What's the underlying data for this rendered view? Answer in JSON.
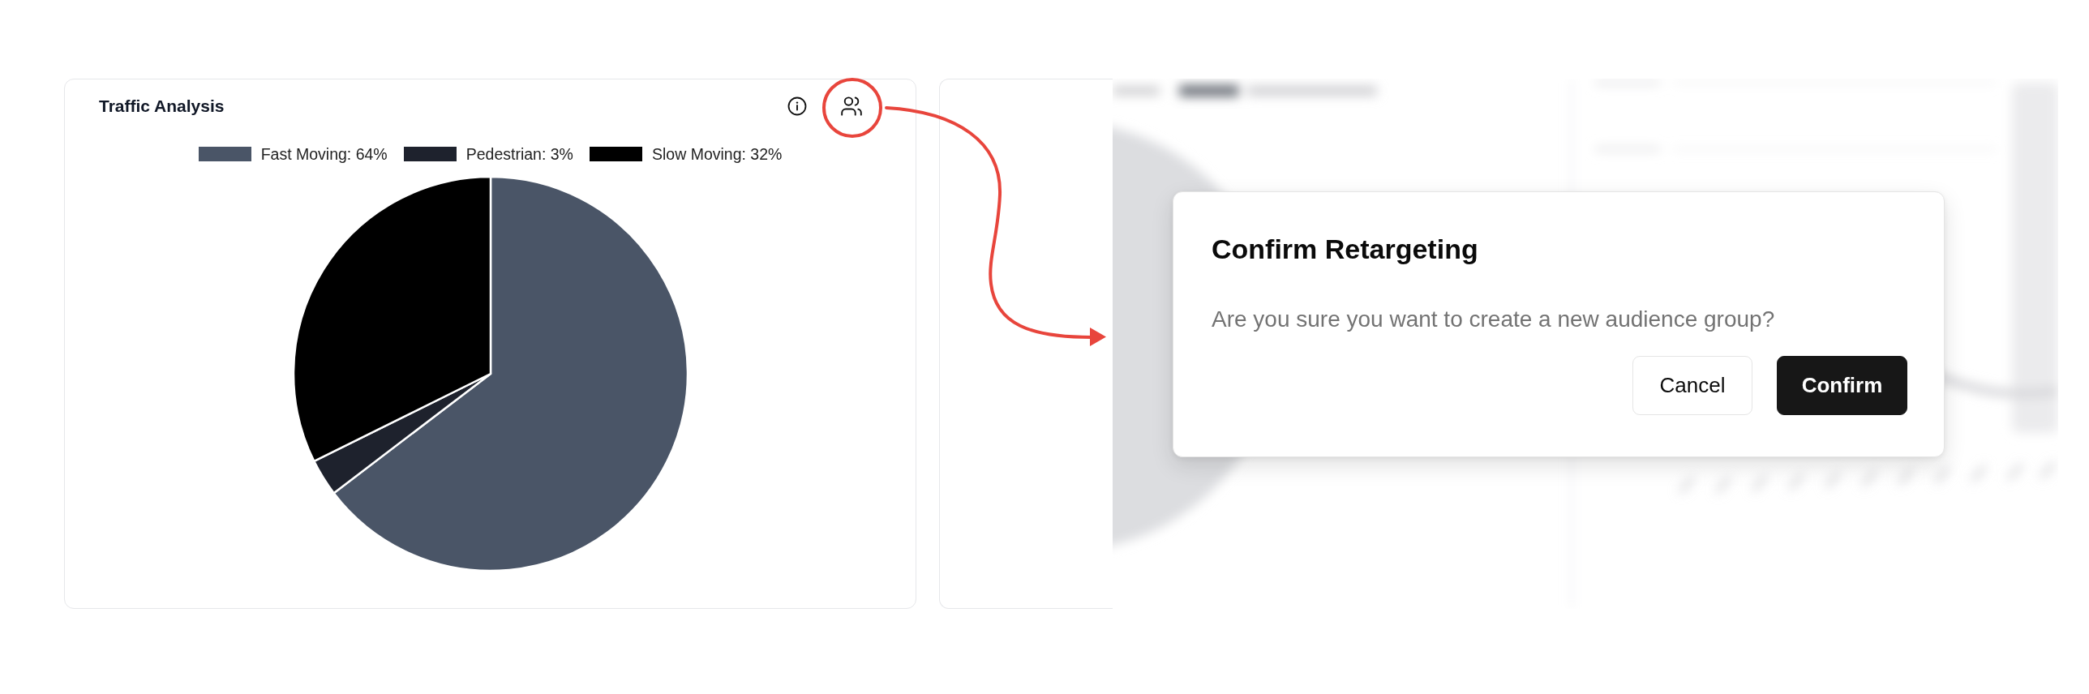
{
  "chart_card": {
    "title": "Traffic Analysis",
    "legend": [
      {
        "label": "Fast Moving: 64%",
        "color": "#4a5567"
      },
      {
        "label": "Pedestrian: 3%",
        "color": "#1e222d"
      },
      {
        "label": "Slow Moving: 32%",
        "color": "#000000"
      }
    ],
    "chart_data": {
      "type": "pie",
      "values": [
        64,
        3,
        32
      ]
    }
  },
  "dialog": {
    "title": "Confirm Retargeting",
    "message": "Are you sure you want to create a new audience group?",
    "buttons": [
      {
        "label": "Cancel",
        "kind": "secondary"
      },
      {
        "label": "Confirm",
        "kind": "primary"
      }
    ]
  }
}
